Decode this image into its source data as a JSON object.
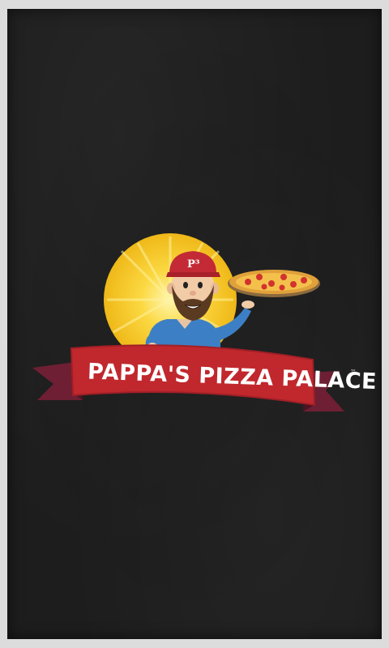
{
  "logo": {
    "brand_name": "PAPPA'S PIZZA PALACE",
    "trademark": "™",
    "cap_monogram": "P³"
  },
  "colors": {
    "mat_background": "#1d1d1d",
    "sun_yellow": "#f5c21b",
    "ribbon_red": "#c0282d",
    "ribbon_dark": "#6e1f33",
    "cap_red": "#c32a35",
    "shirt_blue": "#3d7fc4",
    "pizza_crust": "#e0a13a",
    "pepperoni": "#d3322e"
  },
  "icons": [
    "pizza-chef-mascot",
    "pizza-icon",
    "sun-burst"
  ]
}
